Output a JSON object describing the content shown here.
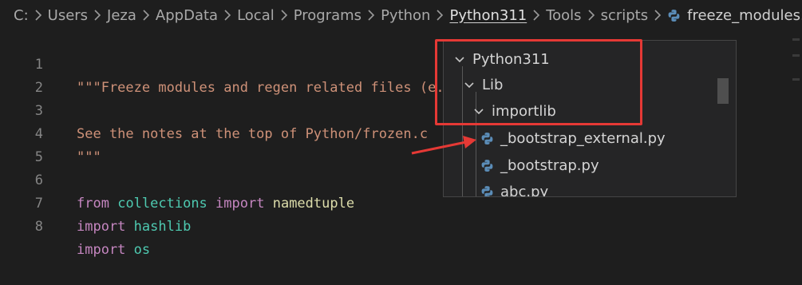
{
  "breadcrumb": {
    "items": [
      "C:",
      "Users",
      "Jeza",
      "AppData",
      "Local",
      "Programs",
      "Python",
      "Python311",
      "Tools",
      "scripts"
    ],
    "file": "freeze_modules.py",
    "active_item": "Python311",
    "file_icon": "python-icon"
  },
  "editor": {
    "lines": [
      {
        "number": "1",
        "text": "\"\"\"Freeze modules and regen related files (e.g. Python/frozen.c)"
      },
      {
        "number": "2",
        "text": ""
      },
      {
        "number": "3",
        "text": "See the notes at the top of Python/frozen.c"
      },
      {
        "number": "4",
        "text": "\"\"\""
      },
      {
        "number": "5",
        "text": ""
      },
      {
        "number": "6",
        "keyword1": "from",
        "module": "collections",
        "keyword2": "import",
        "name": "namedtuple"
      },
      {
        "number": "7",
        "keyword": "import",
        "module": "hashlib"
      },
      {
        "number": "8",
        "keyword": "import",
        "module": "os"
      }
    ]
  },
  "dropdown": {
    "items": [
      {
        "label": "Python311",
        "type": "folder",
        "expanded": true
      },
      {
        "label": "Lib",
        "type": "folder",
        "expanded": true
      },
      {
        "label": "importlib",
        "type": "folder",
        "expanded": true
      },
      {
        "label": "_bootstrap_external.py",
        "type": "file",
        "icon": "python-icon"
      },
      {
        "label": "_bootstrap.py",
        "type": "file",
        "icon": "python-icon"
      },
      {
        "label": "abc.py",
        "type": "file",
        "icon": "python-icon"
      }
    ]
  },
  "colors": {
    "background": "#1e1e1e",
    "annotation": "#e53935",
    "string": "#ce9178",
    "keyword": "#c586c0",
    "module": "#4ec9b0",
    "function": "#dcdcaa"
  }
}
